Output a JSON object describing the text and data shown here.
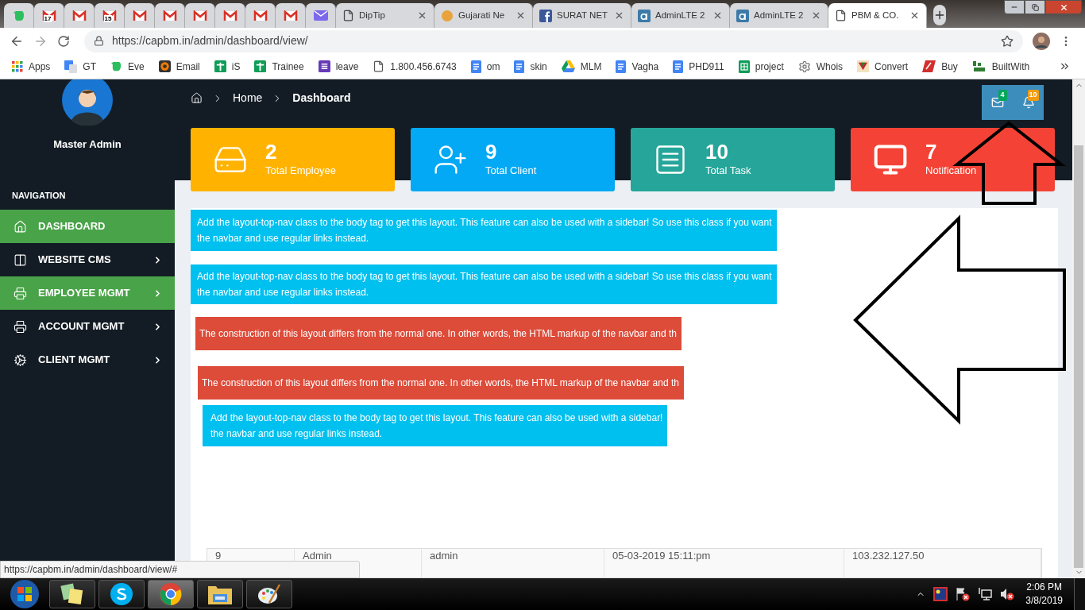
{
  "browser": {
    "tabs": [
      {
        "kind": "evernote",
        "selected": false
      },
      {
        "kind": "gmail",
        "badge": "17",
        "selected": false
      },
      {
        "kind": "gmail",
        "selected": false
      },
      {
        "kind": "gmail",
        "badge": "15",
        "selected": false
      },
      {
        "kind": "gmail",
        "selected": false
      },
      {
        "kind": "gmail",
        "selected": false
      },
      {
        "kind": "gmail",
        "selected": false
      },
      {
        "kind": "gmail",
        "selected": false
      },
      {
        "kind": "gmail",
        "selected": false
      },
      {
        "kind": "gmail",
        "selected": false
      },
      {
        "kind": "mail",
        "selected": false
      },
      {
        "kind": "page",
        "title": "DipTip",
        "selected": false
      },
      {
        "kind": "circle",
        "title": "Gujarati Ne",
        "selected": false
      },
      {
        "kind": "facebook",
        "title": "SURAT NET",
        "selected": false
      },
      {
        "kind": "adminlte",
        "title": "AdminLTE 2",
        "selected": false
      },
      {
        "kind": "adminlte",
        "title": "AdminLTE 2",
        "selected": false
      },
      {
        "kind": "page",
        "title": "PBM & CO.",
        "selected": true
      }
    ]
  },
  "address_bar": {
    "url": "https://capbm.in/admin/dashboard/view/"
  },
  "bookmarks": [
    {
      "kind": "apps",
      "label": "Apps"
    },
    {
      "kind": "translate",
      "label": "GT"
    },
    {
      "kind": "evernote",
      "label": "Eve"
    },
    {
      "kind": "email",
      "label": "Email"
    },
    {
      "kind": "plus",
      "label": "iS"
    },
    {
      "kind": "plus",
      "label": "Trainee"
    },
    {
      "kind": "form",
      "label": "leave"
    },
    {
      "kind": "page",
      "label": "1.800.456.6743"
    },
    {
      "kind": "doc",
      "label": "om"
    },
    {
      "kind": "doc",
      "label": "skin"
    },
    {
      "kind": "drive",
      "label": "MLM"
    },
    {
      "kind": "doc",
      "label": "Vagha"
    },
    {
      "kind": "doc",
      "label": "PHD911"
    },
    {
      "kind": "sheet",
      "label": "project"
    },
    {
      "kind": "gear",
      "label": "Whois"
    },
    {
      "kind": "convert",
      "label": "Convert"
    },
    {
      "kind": "buy",
      "label": "Buy"
    },
    {
      "kind": "builtwith",
      "label": "BuiltWith"
    }
  ],
  "sidebar": {
    "user_name": "Master Admin",
    "section_label": "NAVIGATION",
    "items": [
      {
        "kind": "home",
        "label": "DASHBOARD",
        "highlighted": true,
        "has_submenu": false
      },
      {
        "kind": "columns",
        "label": "WEBSITE CMS",
        "highlighted": false,
        "has_submenu": true
      },
      {
        "kind": "printer",
        "label": "EMPLOYEE MGMT",
        "highlighted": true,
        "has_submenu": true
      },
      {
        "kind": "printer",
        "label": "ACCOUNT MGMT",
        "highlighted": false,
        "has_submenu": true
      },
      {
        "kind": "gear",
        "label": "CLIENT MGMT",
        "highlighted": false,
        "has_submenu": true
      }
    ]
  },
  "header": {
    "breadcrumb": [
      {
        "label": "Home",
        "selected": false
      },
      {
        "label": "Dashboard",
        "selected": true
      }
    ],
    "mail_badge": "4",
    "notification_badge": "10"
  },
  "stat_cards": [
    {
      "kind": "drive",
      "value": "2",
      "label": "Total Employee",
      "color": "#ffb300"
    },
    {
      "kind": "user",
      "value": "9",
      "label": "Total Client",
      "color": "#03a9f4"
    },
    {
      "kind": "list",
      "value": "10",
      "label": "Total Task",
      "color": "#26a69a"
    },
    {
      "kind": "monitor",
      "value": "7",
      "label": "Notification",
      "color": "#f44336"
    }
  ],
  "alerts": [
    {
      "kind": "info",
      "lines": [
        "Add the layout-top-nav class to the body tag to get this layout. This feature can also be used with a sidebar! So use this class if you want",
        "the navbar and use regular links instead."
      ]
    },
    {
      "kind": "info",
      "lines": [
        "Add the layout-top-nav class to the body tag to get this layout. This feature can also be used with a sidebar! So use this class if you want",
        "the navbar and use regular links instead."
      ]
    },
    {
      "kind": "danger",
      "lines": [
        "The construction of this layout differs from the normal one. In other words, the HTML markup of the navbar and th"
      ]
    },
    {
      "kind": "danger",
      "lines": [
        "The construction of this layout differs from the normal one. In other words, the HTML markup of the navbar and th"
      ]
    },
    {
      "kind": "info",
      "lines": [
        "Add the layout-top-nav class to the body tag to get this layout. This feature can also be used with a sidebar!",
        "the navbar and use regular links instead."
      ]
    }
  ],
  "table": {
    "rows": [
      [
        "9",
        "Admin",
        "admin",
        "05-03-2019 15:11:pm",
        "103.232.127.50"
      ]
    ]
  },
  "status_url": "https://capbm.in/admin/dashboard/view/#",
  "taskbar": {
    "apps": [
      {
        "kind": "notes",
        "selected": false
      },
      {
        "kind": "skype",
        "selected": false
      },
      {
        "kind": "chrome",
        "selected": true
      },
      {
        "kind": "folder",
        "selected": false
      },
      {
        "kind": "paint",
        "selected": false
      }
    ],
    "clock": {
      "time": "2:06 PM",
      "date": "3/8/2019"
    }
  }
}
